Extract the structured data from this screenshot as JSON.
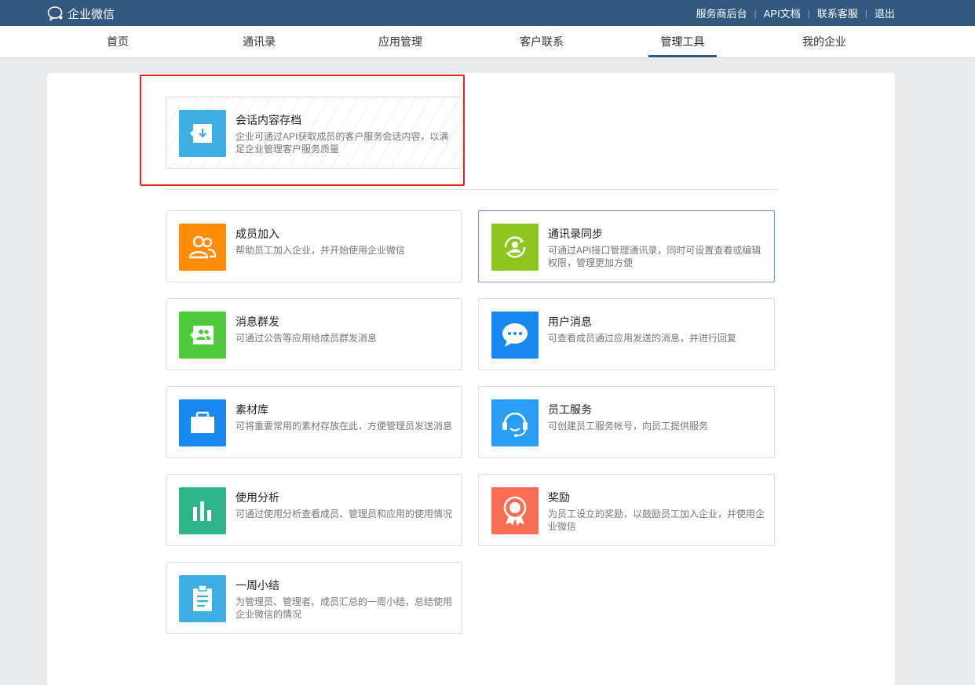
{
  "header": {
    "logo_text": "企业微信",
    "links": [
      "服务商后台",
      "API文档",
      "联系客服",
      "退出"
    ]
  },
  "nav": {
    "tabs": [
      "首页",
      "通讯录",
      "应用管理",
      "客户联系",
      "管理工具",
      "我的企业"
    ],
    "active_tab": "管理工具"
  },
  "featured": {
    "title": "会话内容存档",
    "desc": "企业可通过API获取成员的客户服务会话内容，以满足企业管理客户服务质量",
    "icon": "archive-download-icon",
    "color": "#3eaee2"
  },
  "tools": [
    {
      "title": "成员加入",
      "desc": "帮助员工加入企业，并开始使用企业微信",
      "icon": "members-icon",
      "color": "#ff8d0a"
    },
    {
      "title": "通讯录同步",
      "desc": "可通过API接口管理通讯录，同时可设置查看或编辑权限，管理更加方便",
      "icon": "contacts-sync-icon",
      "color": "#8fc51f"
    },
    {
      "title": "消息群发",
      "desc": "可通过公告等应用给成员群发消息",
      "icon": "broadcast-icon",
      "color": "#4ec93c"
    },
    {
      "title": "用户消息",
      "desc": "可查看成员通过应用发送的消息，并进行回复",
      "icon": "chat-bubble-icon",
      "color": "#1987f0"
    },
    {
      "title": "素材库",
      "desc": "可将重要常用的素材存放在此，方便管理员发送消息",
      "icon": "briefcase-icon",
      "color": "#1987f0"
    },
    {
      "title": "员工服务",
      "desc": "可创建员工服务帐号，向员工提供服务",
      "icon": "headset-icon",
      "color": "#2a9df4"
    },
    {
      "title": "使用分析",
      "desc": "可通过使用分析查看成员、管理员和应用的使用情况",
      "icon": "bar-chart-icon",
      "color": "#2fb388"
    },
    {
      "title": "奖励",
      "desc": "为员工设立的奖励，以鼓励员工加入企业，并使用企业微信",
      "icon": "award-icon",
      "color": "#fb6d53"
    },
    {
      "title": "一周小结",
      "desc": "为管理员、管理者、成员汇总的一周小结，总结使用企业微信的情况",
      "icon": "clipboard-icon",
      "color": "#3eaee2"
    }
  ]
}
